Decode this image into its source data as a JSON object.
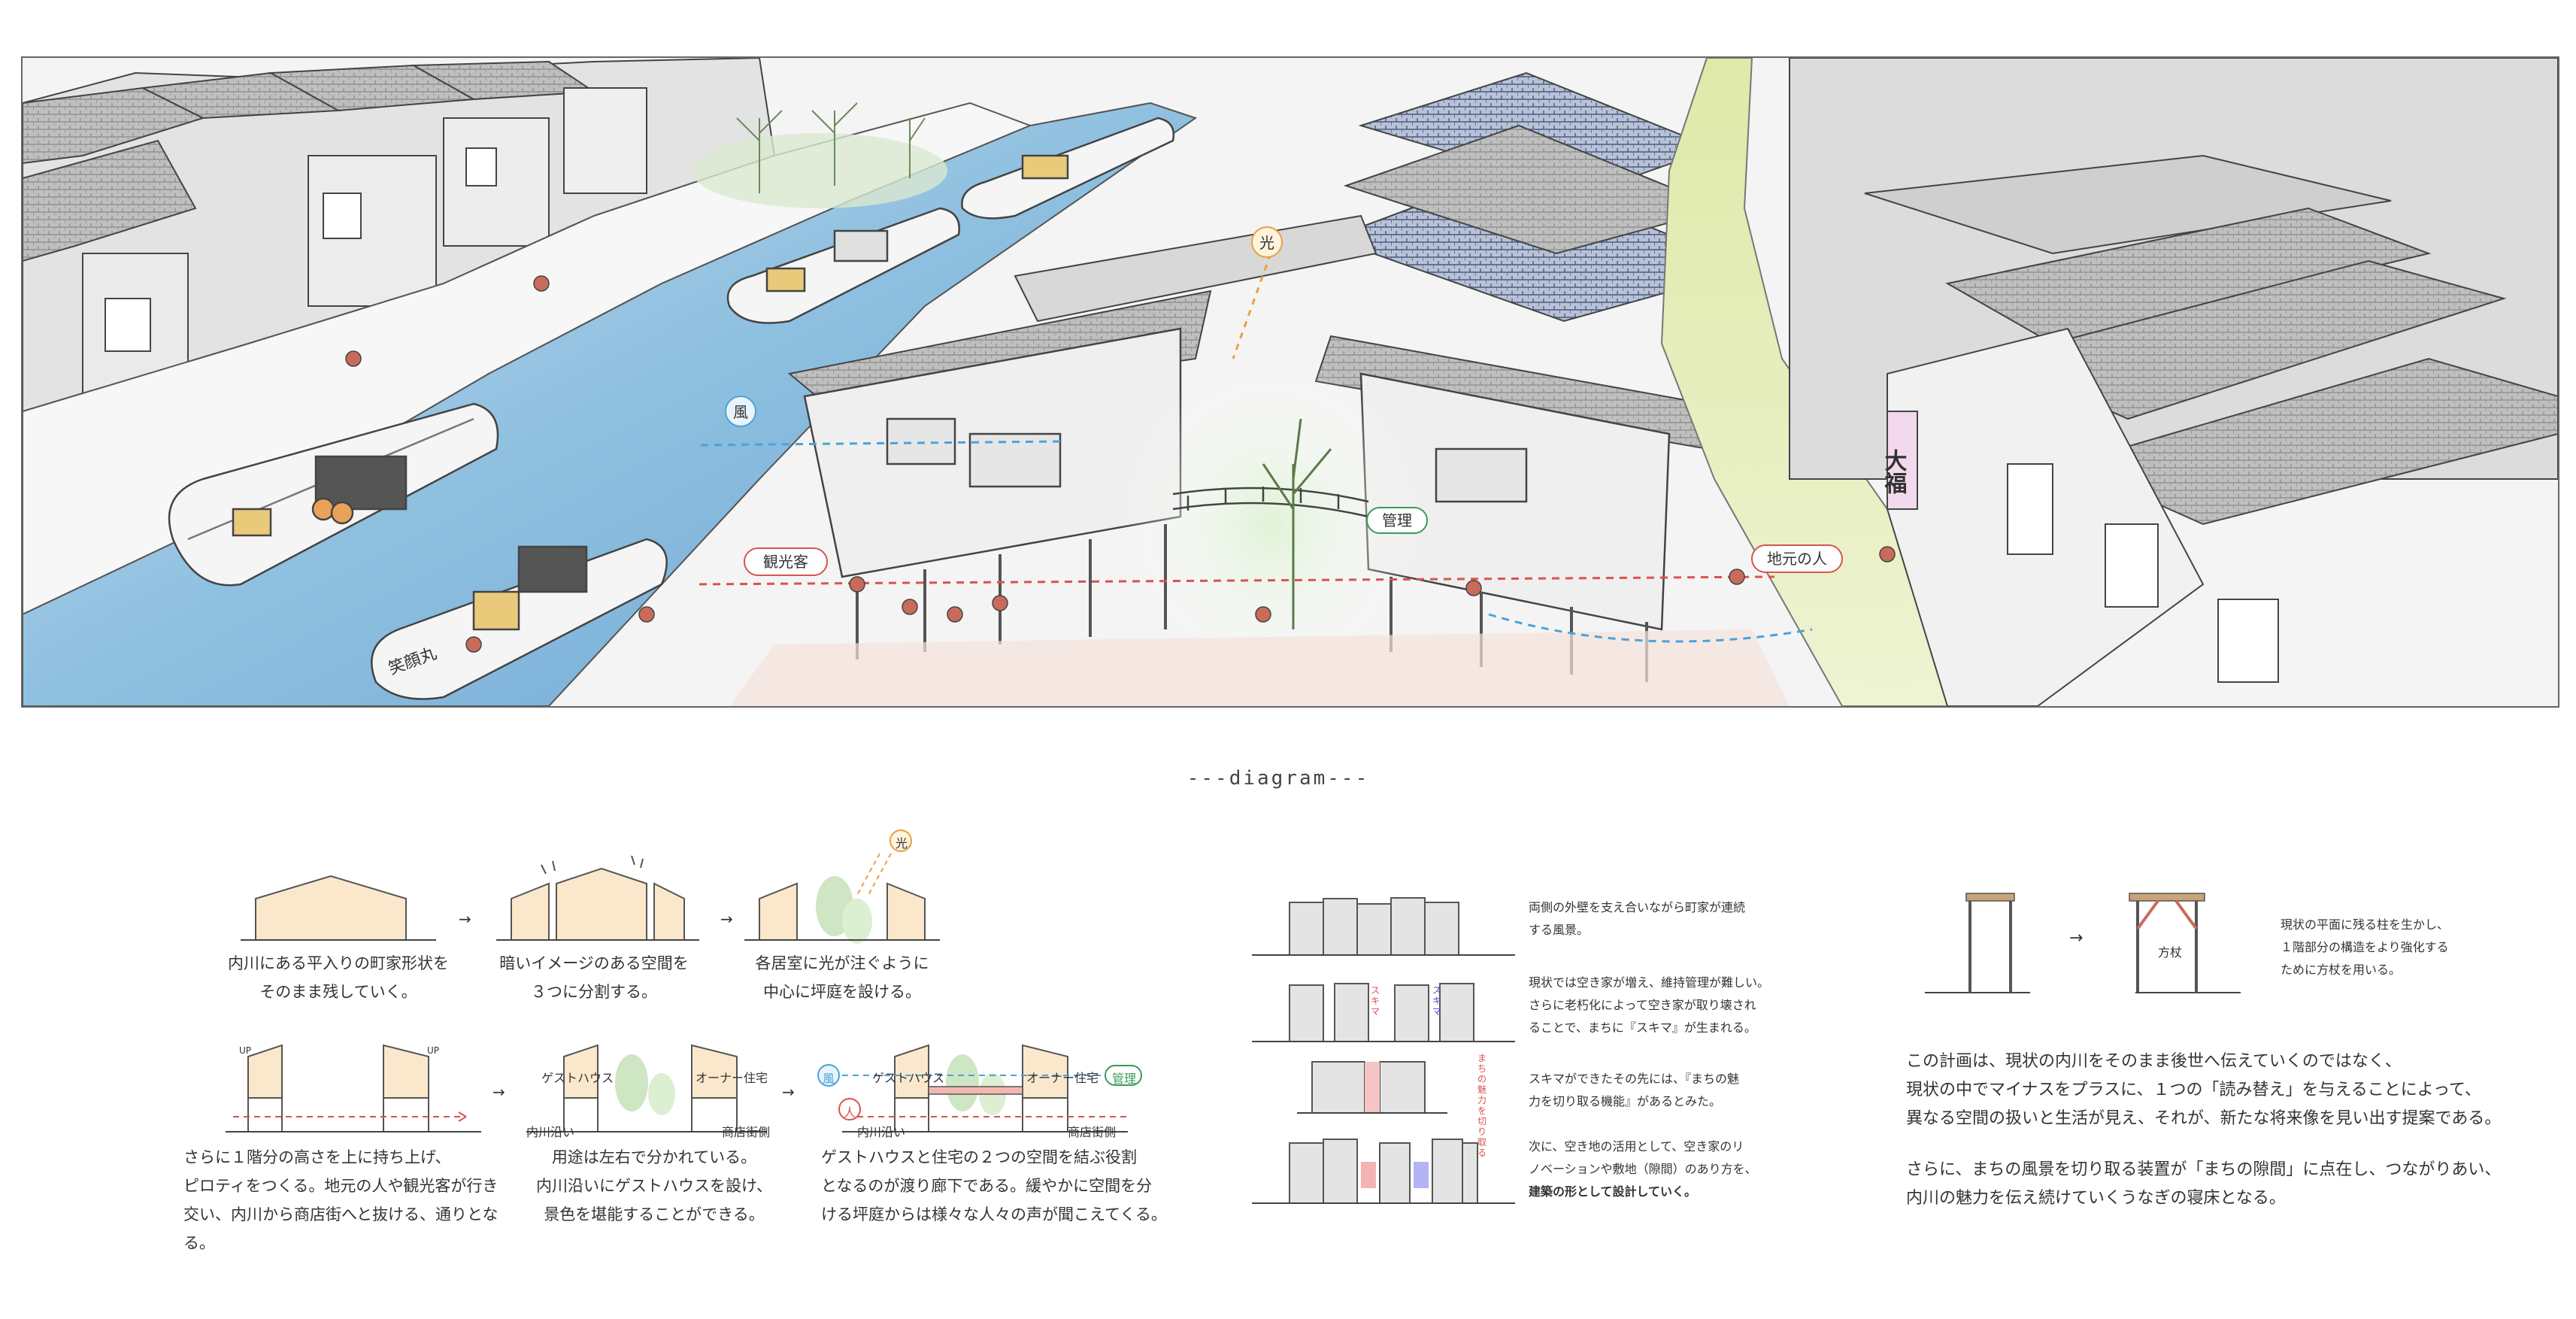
{
  "title": "---diagram---",
  "hero": {
    "labels": {
      "wind": "風",
      "light": "光",
      "tourist": "観光客",
      "local": "地元の人",
      "management": "管理",
      "shop_sign": "大福",
      "boat_name": "笑顔丸"
    },
    "colors": {
      "river": "#8fc0e0",
      "road": "#e9efc4",
      "red_arrow": "#d9534f",
      "blue_arrow": "#4aa3d8",
      "green_label": "#3a9a5c"
    }
  },
  "step1": {
    "caption_lines": [
      "内川にある平入りの町家形状を",
      "そのまま残していく。"
    ],
    "caption_arrow": "→"
  },
  "step2": {
    "caption_lines": [
      "暗いイメージのある空間を",
      "３つに分割する。"
    ]
  },
  "step3": {
    "caption_lines": [
      "各居室に光が注ぐように",
      "中心に坪庭を設ける。"
    ],
    "light_icon": "光"
  },
  "step4": {
    "caption_lines": [
      "さらに１階分の高さを上に持ち上げ、",
      "ピロティをつくる。地元の人や観光客が行き",
      "交い、内川から商店街へと抜ける、通りとなる。"
    ],
    "up_label": "UP"
  },
  "step5": {
    "caption_lines": [
      "用途は左右で分かれている。",
      "内川沿いにゲストハウスを設け、",
      "景色を堪能することができる。"
    ],
    "guesthouse": "ゲストハウス",
    "owner": "オーナー住宅",
    "river_side": "内川沿い",
    "shop_side": "商店街側"
  },
  "step6": {
    "caption_lines": [
      "ゲストハウスと住宅の２つの空間を結ぶ役割",
      "となるのが渡り廊下である。緩やかに空間を分",
      "ける坪庭からは様々な人々の声が聞こえてくる。"
    ],
    "wind": "風",
    "person": "人",
    "manage": "管理",
    "guesthouse": "ゲストハウス",
    "owner": "オーナー住宅",
    "river_side": "内川沿い",
    "shop_side": "商店街側"
  },
  "town": {
    "texts": [
      "両側の外壁を支え合いながら町家が連続する風景。",
      "現状では空き家が増え、維持管理が難しい。さらに老朽化によって空き家が取り壊されることで、まちに『スキマ』が生まれる。",
      "スキマができたその先には、『まちの魅力を切り取る機能』があるとみた。",
      "次に、空き地の活用として、空き家のリノベーションや敷地（隙間）のあり方を、建築の形として設計していく。"
    ],
    "lines": [
      [
        "両側の外壁を支え合いながら町家が連続",
        "する風景。"
      ],
      [
        "現状では空き家が増え、維持管理が難しい。",
        "さらに老朽化によって空き家が取り壊され",
        "ることで、まちに『スキマ』が生まれる。"
      ],
      [
        "スキマができたその先には、『まちの魅",
        "力を切り取る機能』があるとみた。"
      ],
      [
        "次に、空き地の活用として、空き家のリ",
        "ノベーションや敷地（隙間）のあり方を、",
        "建築の形として設計していく。"
      ]
    ],
    "gap_label": "スキマ",
    "cut_label": "まちの魅力を切り取る"
  },
  "frame": {
    "text_lines": [
      "現状の平面に残る柱を生かし、",
      "１階部分の構造をより強化する",
      "ために方杖を用いる。"
    ],
    "brace_label": "方杖",
    "arrow": "→"
  },
  "summary": {
    "p1": [
      "この計画は、現状の内川をそのまま後世へ伝えていくのではなく、",
      "現状の中でマイナスをプラスに、１つの「読み替え」を与えることによって、",
      "異なる空間の扱いと生活が見え、それが、新たな将来像を見い出す提案である。"
    ],
    "p2": [
      "さらに、まちの風景を切り取る装置が「まちの隙間」に点在し、つながりあい、",
      "内川の魅力を伝え続けていくうなぎの寝床となる。"
    ]
  }
}
